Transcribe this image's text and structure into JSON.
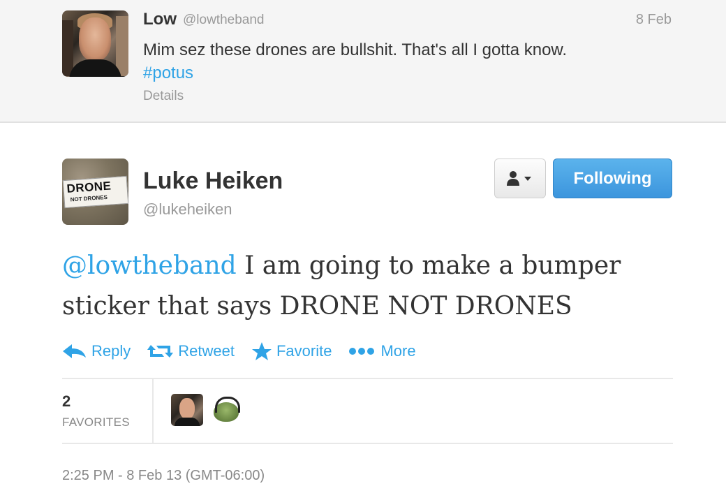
{
  "parent_tweet": {
    "author_name": "Low",
    "author_handle": "@lowtheband",
    "date": "8 Feb",
    "text": "Mim sez these drones are bullshit. That's all I gotta know.",
    "hashtag": "#potus",
    "details_link": "Details"
  },
  "main_tweet": {
    "avatar_sticker_big": "DRONE",
    "avatar_sticker_small": "NOT DRONES",
    "author_name": "Luke Heiken",
    "author_handle": "@lukeheiken",
    "follow_button_label": "Following",
    "text_mention": "@lowtheband",
    "text_body": " I am going to make a bumper sticker that says DRONE NOT DRONES",
    "actions": {
      "reply": "Reply",
      "retweet": "Retweet",
      "favorite": "Favorite",
      "more": "More"
    },
    "favorites_count": "2",
    "favorites_label": "FAVORITES",
    "timestamp": "2:25 PM - 8 Feb 13 (GMT-06:00)"
  },
  "colors": {
    "link_blue": "#2fa3e6",
    "button_blue": "#4aa5e5",
    "muted_gray": "#999999"
  }
}
